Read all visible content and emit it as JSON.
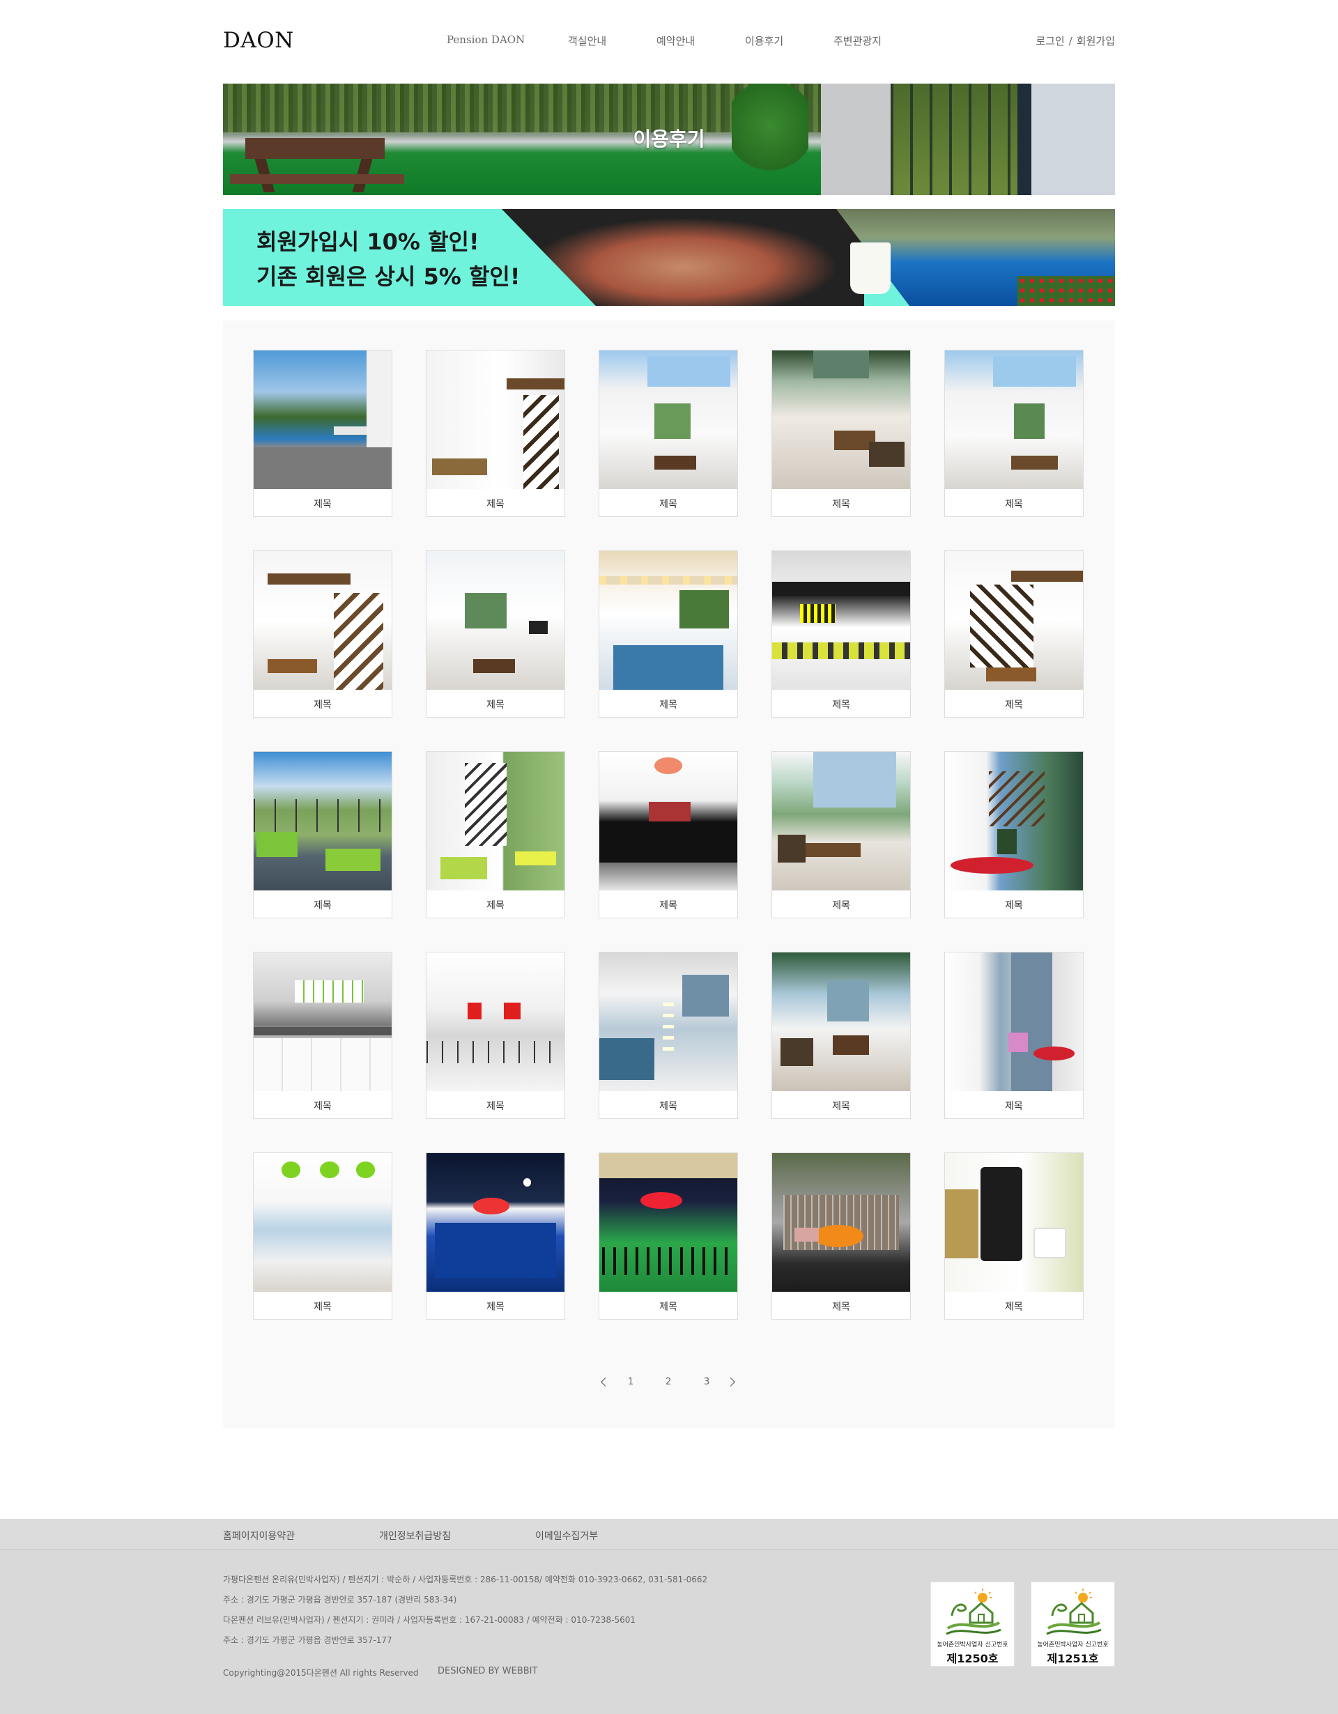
{
  "header": {
    "logo": "DAON",
    "nav": [
      "Pension DAON",
      "객실안내",
      "예약안내",
      "이용후기",
      "주변관광지"
    ],
    "login": "로그인",
    "separator": "/",
    "signup": "회원가입"
  },
  "page_banner": {
    "title": "이용후기"
  },
  "promo": {
    "line1": "회원가입시 10% 할인!",
    "line2": "기존 회원은 상시 5% 할인!"
  },
  "gallery": {
    "items": [
      "제목",
      "제목",
      "제목",
      "제목",
      "제목",
      "제목",
      "제목",
      "제목",
      "제목",
      "제목",
      "제목",
      "제목",
      "제목",
      "제목",
      "제목",
      "제목",
      "제목",
      "제목",
      "제목",
      "제목",
      "제목",
      "제목",
      "제목",
      "제목",
      "제목"
    ]
  },
  "pagination": {
    "pages": [
      "1",
      "2",
      "3"
    ]
  },
  "footer": {
    "links": [
      "홈페이지이용약관",
      "개인정보취급방침",
      "이메일수집거부"
    ],
    "info": [
      "가평다온펜션 온리유(민박사업자) / 펜션지기 : 박순하 / 사업자등록번호 : 286-11-00158/ 예약전화 010-3923-0662, 031-581-0662",
      "주소 : 경기도 가평군 가평읍 경반안로 357-187 (경반리 583-34)",
      "다온펜션 러브유(민박사업자) / 펜션지기 : 권미라 / 사업자등록번호 : 167-21-00083 / 예약전화 : 010-7238-5601",
      "주소 : 경기도 가평군 가평읍 경반안로 357-177"
    ],
    "copyright": "Copyrighting@2015다온펜션 All rights Reserved",
    "designed_by": "DESIGNED BY WEBBIT",
    "badges": [
      {
        "label": "농어촌민박사업자 신고번호",
        "number": "제1250호"
      },
      {
        "label": "농어촌민박사업자 신고번호",
        "number": "제1251호"
      }
    ]
  },
  "colors": {
    "promo_background": "#6ff3dc",
    "gallery_background": "#f9f9f9",
    "footer_background": "#d9d9d9"
  }
}
